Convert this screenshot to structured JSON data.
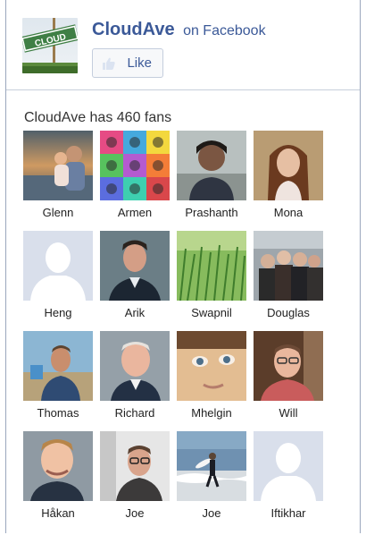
{
  "header": {
    "page_name": "CloudAve",
    "on_facebook": "on Facebook",
    "like_label": "Like",
    "logo_text": "CLOUD",
    "logo_icon": "cloudave-sign-logo"
  },
  "fans": {
    "summary": "CloudAve has 460 fans",
    "people": [
      {
        "name": "Glenn",
        "avatar": "sunset-couple-photo"
      },
      {
        "name": "Armen",
        "avatar": "colorful-pop-art-grid"
      },
      {
        "name": "Prashanth",
        "avatar": "man-portrait-photo"
      },
      {
        "name": "Mona",
        "avatar": "woman-portrait-photo"
      },
      {
        "name": "Heng",
        "avatar": "default-silhouette"
      },
      {
        "name": "Arik",
        "avatar": "man-suit-portrait"
      },
      {
        "name": "Swapnil",
        "avatar": "green-grass-photo"
      },
      {
        "name": "Douglas",
        "avatar": "group-photo"
      },
      {
        "name": "Thomas",
        "avatar": "man-outdoors-photo"
      },
      {
        "name": "Richard",
        "avatar": "older-man-portrait"
      },
      {
        "name": "Mhelgin",
        "avatar": "close-up-face-photo"
      },
      {
        "name": "Will",
        "avatar": "man-glasses-portrait"
      },
      {
        "name": "Håkan",
        "avatar": "smiling-man-portrait"
      },
      {
        "name": "Joe",
        "avatar": "man-glasses-suit-portrait"
      },
      {
        "name": "Joe",
        "avatar": "surfer-photo"
      },
      {
        "name": "Iftikhar",
        "avatar": "default-silhouette"
      }
    ]
  },
  "colors": {
    "facebook_blue": "#3b5998",
    "border": "#9aa7bd",
    "silhouette_bg": "#d9dfeb"
  }
}
